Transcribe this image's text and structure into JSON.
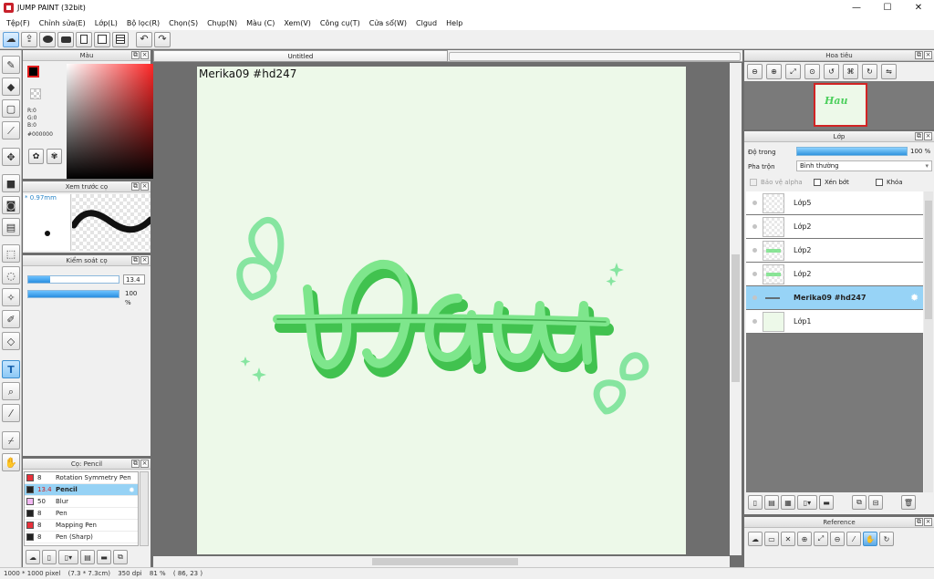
{
  "window": {
    "title": "JUMP PAINT (32bit)",
    "minimize": "—",
    "maximize": "☐",
    "close": "✕"
  },
  "menu": [
    "Tệp(F)",
    "Chỉnh sửa(E)",
    "Lớp(L)",
    "Bộ lọc(R)",
    "Chọn(S)",
    "Chụp(N)",
    "Màu (C)",
    "Xem(V)",
    "Công cụ(T)",
    "Cửa sổ(W)",
    "Clgud",
    "Help"
  ],
  "colors": {
    "accent": "#3d8fd0",
    "selection": "#97d3f6",
    "canvas_bg": "#edf9e9",
    "lettering": "#4ccf5c",
    "foreground": "#000000"
  },
  "color_panel": {
    "title": "Màu",
    "r": "R:0",
    "g": "G:0",
    "b": "B:0",
    "hex": "#000000"
  },
  "preview_panel": {
    "title": "Xem trước cọ",
    "size": "* 0.97mm"
  },
  "control_panel": {
    "title": "Kiểm soát cọ",
    "size_value": "13.4",
    "size_fraction": 0.24,
    "opacity_value": "100 %",
    "opacity_fraction": 1.0
  },
  "brush_panel": {
    "title": "Cọ: Pencil",
    "items": [
      {
        "size": "8",
        "name": "Rotation Symmetry Pen",
        "color": "#e8303a",
        "selected": false
      },
      {
        "size": "13.4",
        "name": "Pencil",
        "color": "#222222",
        "selected": true
      },
      {
        "size": "50",
        "name": "Blur",
        "color": "#f3b8f3",
        "selected": false
      },
      {
        "size": "8",
        "name": "Pen",
        "color": "#222222",
        "selected": false
      },
      {
        "size": "8",
        "name": "Mapping Pen",
        "color": "#e8303a",
        "selected": false
      },
      {
        "size": "8",
        "name": "Pen (Sharp)",
        "color": "#222222",
        "selected": false
      }
    ]
  },
  "document": {
    "tab_title": "Untitled",
    "caption": "Merika09  #hd247",
    "lettering": "Hau"
  },
  "navigator": {
    "title": "Hoa tiêu",
    "thumb_text": "Hau"
  },
  "layer_panel": {
    "title": "Lớp",
    "opacity_label": "Độ trong",
    "opacity_value": "100 %",
    "blend_label": "Pha trộn",
    "blend_value": "Bình thường",
    "protect_alpha": "Bảo vệ alpha",
    "clipping": "Xén bớt",
    "lock": "Khóa",
    "layers": [
      {
        "name": "Lớp5",
        "selected": false,
        "filled": false,
        "art": false
      },
      {
        "name": "Lớp2",
        "selected": false,
        "filled": false,
        "art": false
      },
      {
        "name": "Lớp2",
        "selected": false,
        "filled": false,
        "art": true
      },
      {
        "name": "Lớp2",
        "selected": false,
        "filled": false,
        "art": true
      },
      {
        "name": "Merika09  #hd247",
        "selected": true,
        "filled": false,
        "art": false
      },
      {
        "name": "Lớp1",
        "selected": false,
        "filled": true,
        "art": false
      }
    ]
  },
  "reference_panel": {
    "title": "Reference"
  },
  "status": {
    "pixels": "1000 * 1000 pixel",
    "cm": "(7.3 * 7.3cm)",
    "dpi": "350 dpi",
    "zoom": "81 %",
    "coords": "( 86, 23 )"
  }
}
